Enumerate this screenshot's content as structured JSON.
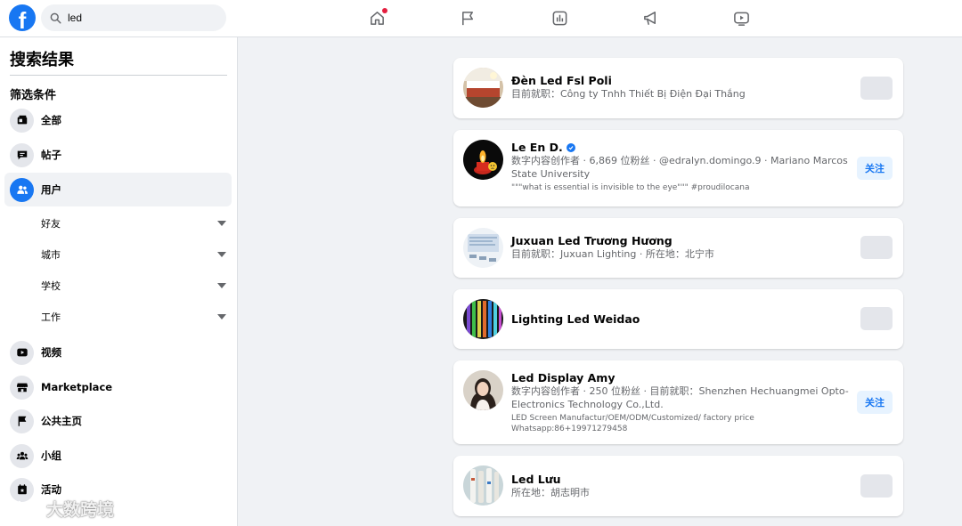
{
  "search": {
    "value": "led"
  },
  "sidebar": {
    "title": "搜索结果",
    "filter_heading": "筛选条件",
    "items": [
      {
        "label": "全部",
        "icon": "all-results-icon"
      },
      {
        "label": "帖子",
        "icon": "posts-icon"
      },
      {
        "label": "用户",
        "icon": "people-icon",
        "active": true
      },
      {
        "label": "视频",
        "icon": "video-icon"
      },
      {
        "label": "Marketplace",
        "icon": "marketplace-icon"
      },
      {
        "label": "公共主页",
        "icon": "pages-flag-icon"
      },
      {
        "label": "小组",
        "icon": "groups-icon"
      },
      {
        "label": "活动",
        "icon": "events-icon"
      }
    ],
    "sub_filters": [
      {
        "label": "好友"
      },
      {
        "label": "城市"
      },
      {
        "label": "学校"
      },
      {
        "label": "工作"
      }
    ]
  },
  "results": [
    {
      "name": "Đèn Led Fsl Poli",
      "subtitle": "目前就职：Công ty Tnhh Thiết Bị Điện Đại Thắng"
    },
    {
      "name": "Le En D.",
      "verified": true,
      "subtitle": "数字内容创作者 · 6,869 位粉丝 · @edralyn.domingo.9 · Mariano Marcos State University",
      "description": "\"\"\"what is essential is invisible to the eye\"\"\" #proudilocana",
      "button": "关注"
    },
    {
      "name": "Juxuan Led Trương Hương",
      "subtitle": "目前就职：Juxuan Lighting · 所在地：北宁市"
    },
    {
      "name": "Lighting Led Weidao"
    },
    {
      "name": "Led Display Amy",
      "subtitle": "数字内容创作者 · 250 位粉丝 · 目前就职：Shenzhen Hechuangmei Opto-Electronics Technology Co.,Ltd.",
      "description_line1": "LED Screen Manufactur/OEM/ODM/Customized/ factory price",
      "description_line2": "Whatsapp:86+19971279458",
      "button": "关注"
    },
    {
      "name": "Led Lưu",
      "subtitle": "所在地：胡志明市"
    }
  ],
  "watermark": {
    "text": "大数跨境"
  },
  "colors": {
    "brand": "#1877f2",
    "background": "#f0f2f5",
    "follow_bg": "#e7f3ff"
  }
}
